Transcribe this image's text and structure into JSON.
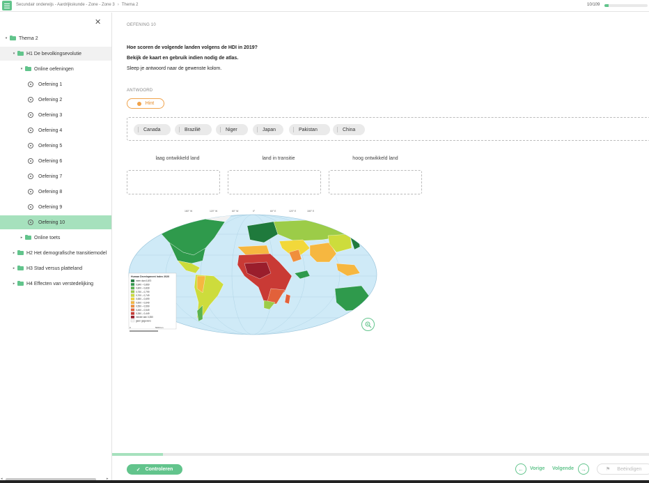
{
  "topbar": {
    "breadcrumb": [
      "Secundair onderwijs - Aardrijkskunde - Zone - Zone 3",
      "Thema 2"
    ],
    "progress_text": "10/109",
    "progress_fraction": 0.092
  },
  "sidebar": {
    "items": [
      {
        "label": "Thema 2",
        "type": "folder",
        "level": 0,
        "expanded": true
      },
      {
        "label": "H1 De bevolkingsevolutie",
        "type": "folder",
        "level": 1,
        "expanded": true,
        "highlighted": true
      },
      {
        "label": "Online oefeningen",
        "type": "folder",
        "level": 2,
        "expanded": true
      },
      {
        "label": "Oefening 1",
        "type": "exercise",
        "level": 3
      },
      {
        "label": "Oefening 2",
        "type": "exercise",
        "level": 3
      },
      {
        "label": "Oefening 3",
        "type": "exercise",
        "level": 3
      },
      {
        "label": "Oefening 4",
        "type": "exercise",
        "level": 3
      },
      {
        "label": "Oefening 5",
        "type": "exercise",
        "level": 3
      },
      {
        "label": "Oefening 6",
        "type": "exercise",
        "level": 3
      },
      {
        "label": "Oefening 7",
        "type": "exercise",
        "level": 3
      },
      {
        "label": "Oefening 8",
        "type": "exercise",
        "level": 3
      },
      {
        "label": "Oefening 9",
        "type": "exercise",
        "level": 3
      },
      {
        "label": "Oefening 10",
        "type": "exercise",
        "level": 3,
        "active": true
      },
      {
        "label": "Online toets",
        "type": "folder",
        "level": 2,
        "expanded": false
      },
      {
        "label": "H2 Het demografische transitiemodel",
        "type": "folder",
        "level": 1,
        "expanded": false
      },
      {
        "label": "H3 Stad versus platteland",
        "type": "folder",
        "level": 1,
        "expanded": false
      },
      {
        "label": "H4 Effecten van verstedelijking",
        "type": "folder",
        "level": 1,
        "expanded": false
      }
    ]
  },
  "exercise": {
    "title": "OEFENING 10",
    "question_1": "Hoe scoren de volgende landen volgens de HDI in 2019?",
    "question_2": "Bekijk de kaart en gebruik indien nodig de atlas.",
    "instruction": "Sleep je antwoord naar de gewenste kolom.",
    "answer_label": "ANTWOORD",
    "hint_label": "Hint",
    "chips": [
      "Canada",
      "Brazilië",
      "Niger",
      "Japan",
      "Pakistan",
      "China"
    ],
    "columns": [
      "laag ontwikkeld land",
      "land in transitie",
      "hoog ontwikkeld land"
    ],
    "map": {
      "legend_title": "Human Development Index 2020",
      "legend_items": [
        {
          "label": "meer dan 0,870",
          "color": "#1f7a3c"
        },
        {
          "label": "0,840 – 0,869",
          "color": "#2f9a4c"
        },
        {
          "label": "0,800 – 0,839",
          "color": "#5bb34e"
        },
        {
          "label": "0,750 – 0,799",
          "color": "#9ccc48"
        },
        {
          "label": "0,700 – 0,749",
          "color": "#cddc3c"
        },
        {
          "label": "0,650 – 0,699",
          "color": "#f2d83a"
        },
        {
          "label": "0,600 – 0,649",
          "color": "#f6b740"
        },
        {
          "label": "0,550 – 0,599",
          "color": "#f08f3c"
        },
        {
          "label": "0,450 – 0,549",
          "color": "#e2613a"
        },
        {
          "label": "0,350 – 0,449",
          "color": "#c93a35"
        },
        {
          "label": "minder dan 0,350",
          "color": "#9a1e2c"
        },
        {
          "label": "geen gegevens",
          "color": "#f2f2f2"
        }
      ],
      "scale": [
        "0",
        "5000 km"
      ],
      "top_labels": [
        "180° W",
        "120° W",
        "60° W",
        "0°",
        "60° E",
        "120° E",
        "180° E"
      ]
    }
  },
  "footer": {
    "check_label": "Controleren",
    "prev_label": "Vorige",
    "next_label": "Volgende",
    "finish_label": "Beëindigen",
    "progress_fraction": 0.095
  },
  "colors": {
    "accent": "#62c48c",
    "hint": "#f0a24a",
    "active_bg": "#a6e1bd"
  }
}
